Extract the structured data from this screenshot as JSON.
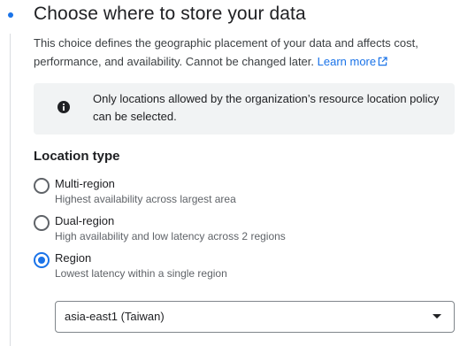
{
  "step": {
    "title": "Choose where to store your data",
    "description": "This choice defines the geographic placement of your data and affects cost, performance, and availability. Cannot be changed later.",
    "learn_more_label": "Learn more",
    "accent_color": "#1a73e8"
  },
  "notice": {
    "icon": "info-icon",
    "text": "Only locations allowed by the organization’s resource location policy can be selected."
  },
  "location_type": {
    "label": "Location type",
    "options": [
      {
        "label": "Multi-region",
        "description": "Highest availability across largest area",
        "selected": false
      },
      {
        "label": "Dual-region",
        "description": "High availability and low latency across 2 regions",
        "selected": false
      },
      {
        "label": "Region",
        "description": "Lowest latency within a single region",
        "selected": true
      }
    ]
  },
  "region_select": {
    "value": "asia-east1 (Taiwan)",
    "icon": "chevron-down-icon"
  }
}
